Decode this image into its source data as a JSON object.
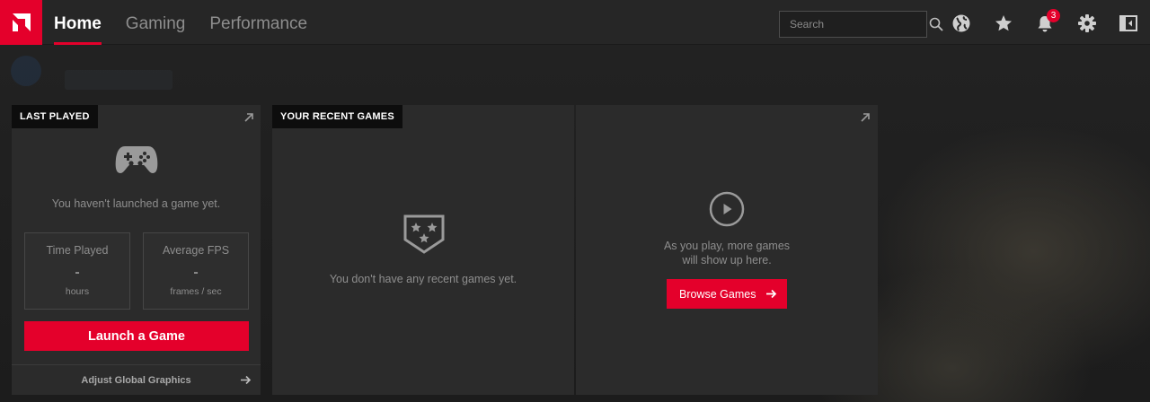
{
  "nav": {
    "tabs": [
      "Home",
      "Gaming",
      "Performance"
    ],
    "active": "Home"
  },
  "search": {
    "placeholder": "Search"
  },
  "notifications": {
    "count": "3"
  },
  "last_played": {
    "tag": "LAST PLAYED",
    "empty_message": "You haven't launched a game yet.",
    "stats": [
      {
        "title": "Time Played",
        "value": "-",
        "unit": "hours"
      },
      {
        "title": "Average FPS",
        "value": "-",
        "unit": "frames / sec"
      }
    ],
    "launch_label": "Launch a Game",
    "adjust_label": "Adjust Global Graphics"
  },
  "recent_games": {
    "tag": "YOUR RECENT GAMES",
    "empty_message": "You don't have any recent games yet.",
    "hint_line1": "As you play, more games",
    "hint_line2": "will show up here.",
    "browse_label": "Browse Games"
  },
  "colors": {
    "accent": "#e4002b",
    "topbar": "#262626",
    "panel": "#2b2b2b",
    "tag_bg": "#0d0d0d",
    "muted_text": "#8e8e8e"
  },
  "icons": {
    "logo": "amd-logo-icon",
    "search": "search-icon",
    "globe": "globe-icon",
    "star": "star-icon",
    "bell": "bell-icon",
    "gear": "gear-icon",
    "layout": "layout-toggle-icon",
    "gamepad": "gamepad-icon",
    "shield": "shield-stars-icon",
    "play": "play-circle-icon",
    "expand": "expand-arrow-icon",
    "arrow": "arrow-right-icon"
  }
}
